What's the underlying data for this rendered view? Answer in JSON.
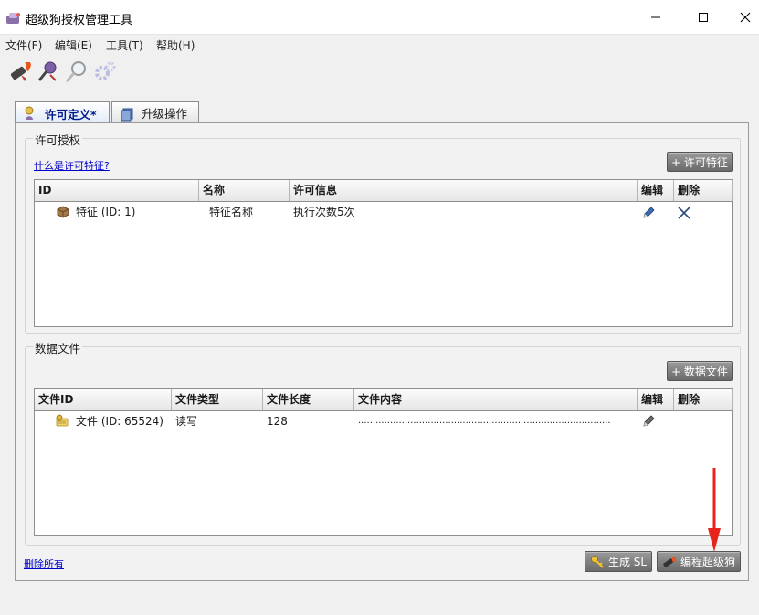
{
  "window": {
    "title": "超级狗授权管理工具",
    "controls": {
      "minimize": "—",
      "maximize": "☐",
      "close": "✕"
    }
  },
  "menu": [
    {
      "label": "文件(F)"
    },
    {
      "label": "编辑(E)"
    },
    {
      "label": "工具(T)"
    },
    {
      "label": "帮助(H)"
    }
  ],
  "toolbar": {
    "icons": [
      "dog-burn-icon",
      "key-search-icon",
      "magnifier-icon",
      "gears-icon"
    ]
  },
  "tabs": [
    {
      "label": "许可定义*",
      "active": true
    },
    {
      "label": "升级操作",
      "active": false
    }
  ],
  "license_section": {
    "title": "许可授权",
    "help_link": "什么是许可特征?",
    "add_button": "+ 许可特征",
    "columns": [
      "ID",
      "名称",
      "许可信息",
      "编辑",
      "删除"
    ],
    "rows": [
      {
        "id": "特征 (ID: 1)",
        "name": "特征名称",
        "info": "执行次数5次"
      }
    ]
  },
  "data_section": {
    "title": "数据文件",
    "add_button": "+ 数据文件",
    "columns": [
      "文件ID",
      "文件类型",
      "文件长度",
      "文件内容",
      "编辑",
      "删除"
    ],
    "rows": [
      {
        "id": "文件 (ID: 65524)",
        "type": "读写",
        "length": "128",
        "content": "......................................................................................."
      }
    ]
  },
  "footer": {
    "delete_all_link": "删除所有",
    "generate_button": "生成 SL",
    "program_button": "编程超级狗"
  },
  "colors": {
    "accent_tab_text": "#001a8c",
    "link": "#0000cc",
    "button_gray": "#7a7a7a",
    "annotation_arrow": "#e8231c"
  }
}
